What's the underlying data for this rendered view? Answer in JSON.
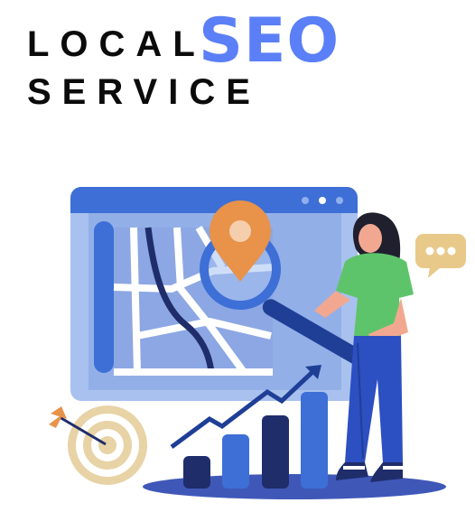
{
  "headline": {
    "line1_prefix": "LOCAL",
    "line1_highlight": "SEO",
    "line2": "SERVICE"
  },
  "colors": {
    "highlight": "#5b7ff7",
    "text": "#0b0b0b",
    "browser_blue": "#3d6fd6",
    "navy": "#1f2d6b",
    "map_pin": "#e8924a",
    "shirt_green": "#5ec46b",
    "speech_bubble": "#e9c98a"
  },
  "icons": {
    "browser": "browser-window-icon",
    "map": "map-icon",
    "pin": "map-pin-icon",
    "magnifier": "magnifying-glass-icon",
    "target": "dartboard-target-icon",
    "chart": "growth-bar-chart-icon",
    "bubble": "speech-bubble-icon"
  }
}
